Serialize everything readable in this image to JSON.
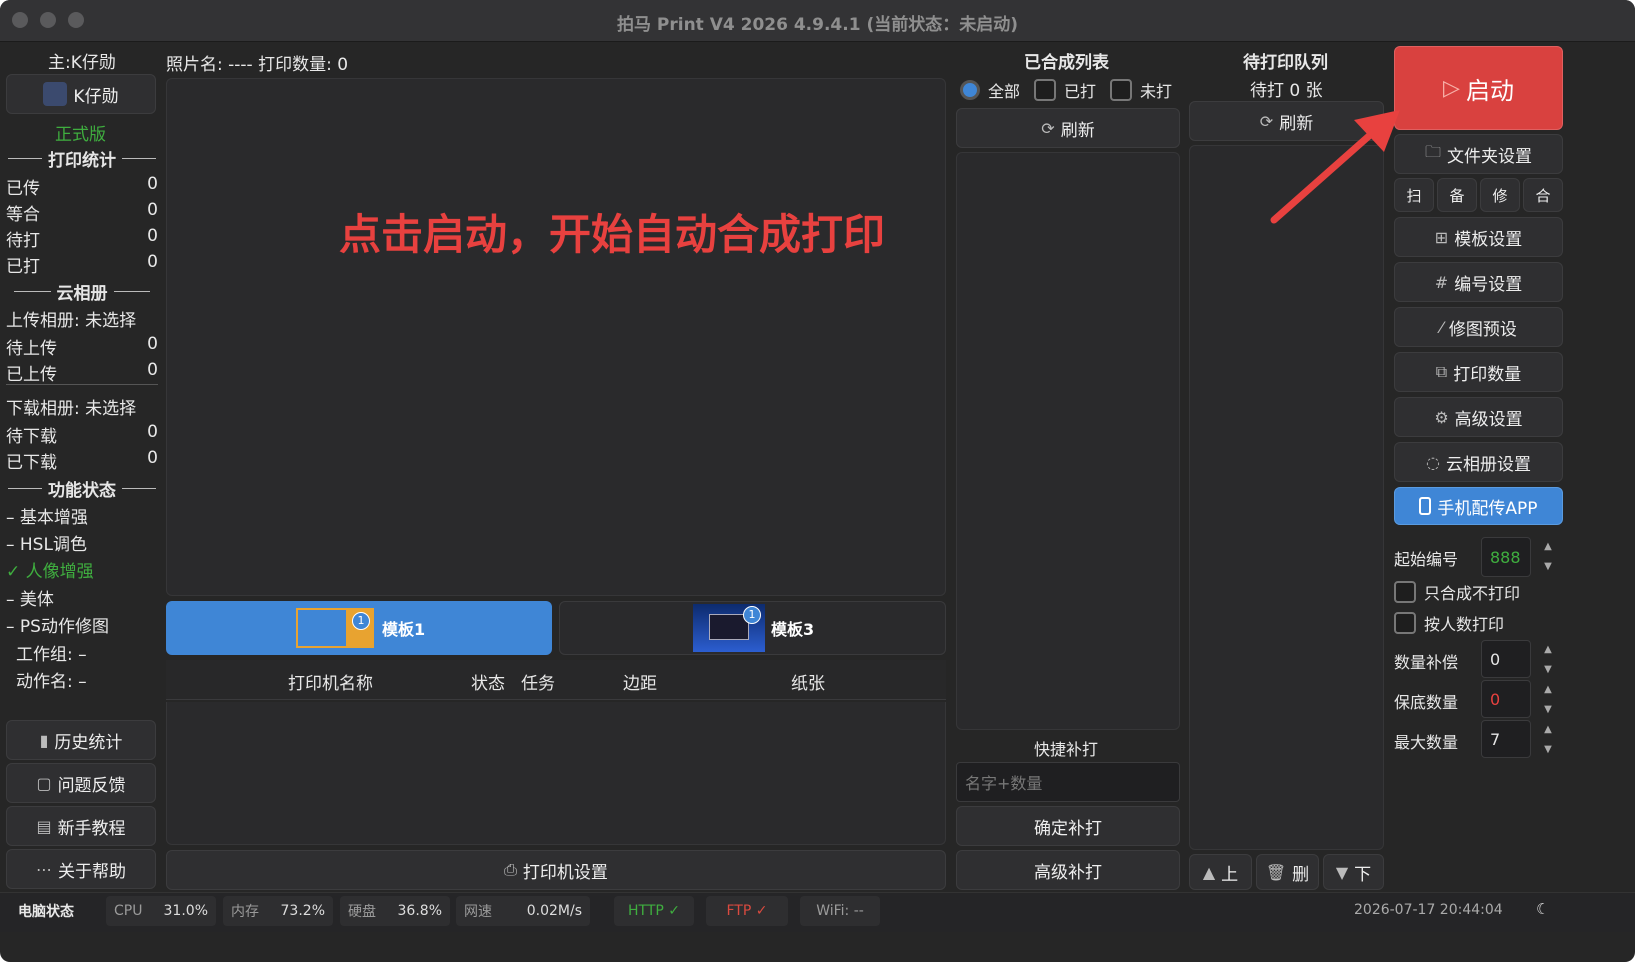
{
  "window": {
    "title": "拍马 Print V4 2026  4.9.4.1 (当前状态：未启动)"
  },
  "left": {
    "host_label": "主:K仔勋",
    "user_button": "K仔勋",
    "edition": "正式版",
    "print_stats_title": "打印统计",
    "stats": [
      {
        "label": "已传",
        "value": "0"
      },
      {
        "label": "等合",
        "value": "0"
      },
      {
        "label": "待打",
        "value": "0"
      },
      {
        "label": "已打",
        "value": "0"
      }
    ],
    "cloud_title": "云相册",
    "upload_album": "上传相册: 未选择",
    "upload_stats": [
      {
        "label": "待上传",
        "value": "0"
      },
      {
        "label": "已上传",
        "value": "0"
      }
    ],
    "download_album": "下载相册: 未选择",
    "download_stats": [
      {
        "label": "待下载",
        "value": "0"
      },
      {
        "label": "已下载",
        "value": "0"
      }
    ],
    "func_title": "功能状态",
    "features": [
      {
        "label": "– 基本增强"
      },
      {
        "label": "– HSL调色"
      },
      {
        "label": "✓ 人像增强"
      },
      {
        "label": "– 美体"
      },
      {
        "label": "– PS动作修图"
      }
    ],
    "workgroup": "工作组: –",
    "action_name": "动作名: –",
    "history_button": "历史统计",
    "feedback_button": "问题反馈",
    "tutorial_button": "新手教程",
    "help_button": "关于帮助"
  },
  "center": {
    "photo_info": "照片名: ---- 打印数量: 0",
    "overlay_text": "点击启动，开始自动合成打印",
    "templates": [
      {
        "label": "模板1",
        "badge": "1"
      },
      {
        "label": "模板3",
        "badge": "1"
      }
    ],
    "printer_columns": [
      "打印机名称",
      "状态",
      "任务",
      "边距",
      "纸张"
    ],
    "printer_settings_button": "打印机设置"
  },
  "composed": {
    "title": "已合成列表",
    "filter_all": "全部",
    "filter_printed": "已打",
    "filter_unprinted": "未打",
    "refresh_button": "刷新",
    "quick_reprint_title": "快捷补打",
    "quick_input_placeholder": "名字+数量",
    "confirm_button": "确定补打",
    "advanced_button": "高级补打"
  },
  "queue": {
    "title": "待打印队列",
    "pending": "待打 0 张",
    "refresh_button": "刷新",
    "up_button": "上",
    "delete_button": "删",
    "down_button": "下"
  },
  "right": {
    "start_button": "启动",
    "folder_button": "文件夹设置",
    "mini_buttons": [
      "扫",
      "备",
      "修",
      "合"
    ],
    "template_button": "模板设置",
    "number_button": "编号设置",
    "retouch_button": "修图预设",
    "print_count_button": "打印数量",
    "advanced_button": "高级设置",
    "cloud_button": "云相册设置",
    "phone_button": "手机配传APP",
    "start_number_label": "起始编号",
    "start_number_value": "888",
    "only_compose_label": "只合成不打印",
    "by_people_label": "按人数打印",
    "qty_comp_label": "数量补偿",
    "qty_comp_value": "0",
    "min_qty_label": "保底数量",
    "min_qty_value": "0",
    "max_qty_label": "最大数量",
    "max_qty_value": "7"
  },
  "statusbar": {
    "computer_status": "电脑状态",
    "cpu_label": "CPU",
    "cpu_value": "31.0%",
    "mem_label": "内存",
    "mem_value": "73.2%",
    "disk_label": "硬盘",
    "disk_value": "36.8%",
    "net_label": "网速",
    "net_value": "0.02M/s",
    "http": "HTTP ✓",
    "ftp": "FTP ✓",
    "wifi": "WiFi: --",
    "datetime": "2026-07-17 20:44:04"
  },
  "colors": {
    "accent_red": "#d9413f",
    "accent_blue": "#3f86d6",
    "green": "#3fae3f",
    "bg": "#262626"
  }
}
